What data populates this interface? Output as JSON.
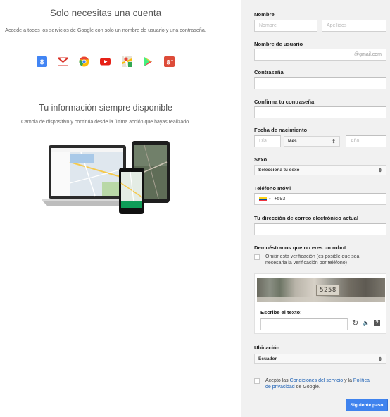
{
  "left": {
    "heading": "Solo necesitas una cuenta",
    "subtitle": "Accede a todos los servicios de Google con solo un nombre de usuario y una contraseña.",
    "apps": [
      {
        "name": "google-search-icon",
        "color": "#4285f4",
        "glyph": "8"
      },
      {
        "name": "gmail-icon",
        "color": "#d93025",
        "glyph": "M"
      },
      {
        "name": "chrome-icon",
        "color": "#fbbc05",
        "glyph": ""
      },
      {
        "name": "youtube-icon",
        "color": "#e62117",
        "glyph": ""
      },
      {
        "name": "maps-icon",
        "color": "#34a853",
        "glyph": ""
      },
      {
        "name": "play-store-icon",
        "color": "#3bccff",
        "glyph": ""
      },
      {
        "name": "google-plus-icon",
        "color": "#dd4b39",
        "glyph": "8+"
      }
    ],
    "heading2": "Tu información siempre disponible",
    "subtitle2": "Cambia de dispositivo y continúa desde la última acción que hayas realizado."
  },
  "form": {
    "name_label": "Nombre",
    "first_name_placeholder": "Nombre",
    "last_name_placeholder": "Apellidos",
    "username_label": "Nombre de usuario",
    "username_suffix": "@gmail.com",
    "password_label": "Contraseña",
    "confirm_label": "Confirma tu contraseña",
    "birthdate_label": "Fecha de nacimiento",
    "day_placeholder": "Día",
    "month_value": "Mes",
    "year_placeholder": "Año",
    "sex_label": "Sexo",
    "sex_value": "Selecciona tu sexo",
    "phone_label": "Teléfono móvil",
    "phone_prefix": "+593",
    "email_label": "Tu dirección de correo electrónico actual",
    "robot_label": "Demuéstranos que no eres un robot",
    "skip_line1": "Omitir esta verificación (es posible que sea",
    "skip_line2": "necesaria la verificación por teléfono)",
    "captcha_text": "5258",
    "captcha_label": "Escribe el texto:",
    "location_label": "Ubicación",
    "location_value": "Ecuador",
    "terms_pre": "Acepto las ",
    "terms_link": "Condiciones del servicio",
    "terms_mid": " y la ",
    "privacy_link1": "Política",
    "privacy_link2": "de privacidad",
    "terms_post": " de Google.",
    "next_button": "Siguiente paso"
  },
  "colors": {
    "accent": "#3f83ee",
    "link": "#1a5fb4",
    "panel_bg": "#f1f1f1"
  }
}
